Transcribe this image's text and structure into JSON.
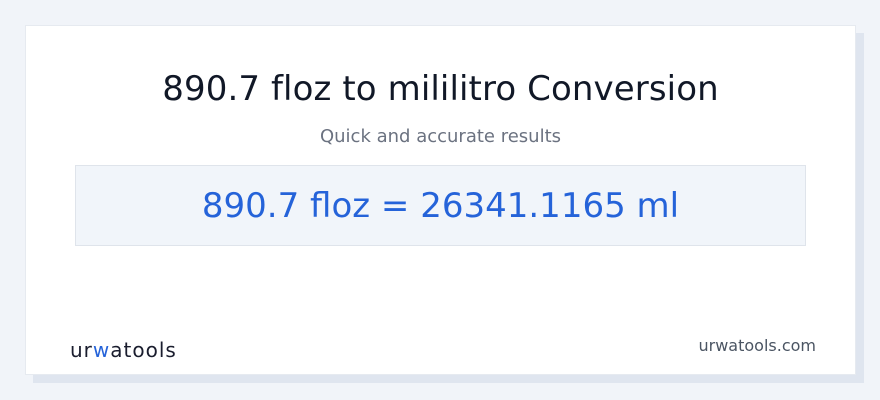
{
  "card": {
    "title": "890.7 floz to mililitro Conversion",
    "subtitle": "Quick and accurate results",
    "result": "890.7 floz = 26341.1165 ml"
  },
  "footer": {
    "logo": {
      "part_a": "ur",
      "part_w": "w",
      "part_b": "atools"
    },
    "site": "urwatools.com"
  },
  "colors": {
    "accent": "#2563d9",
    "title": "#111827",
    "subtitle": "#6b7280",
    "background": "#f1f4f9",
    "result_box": "#f1f5fa"
  }
}
